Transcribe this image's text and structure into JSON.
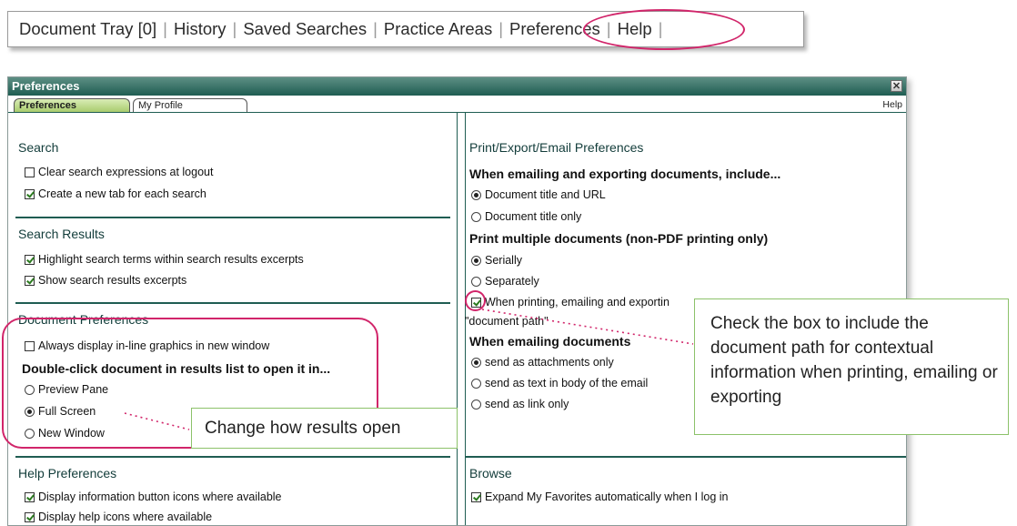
{
  "topnav": {
    "items": [
      {
        "label": "Document Tray [0]"
      },
      {
        "label": "History"
      },
      {
        "label": "Saved Searches"
      },
      {
        "label": "Practice Areas"
      },
      {
        "label": "Preferences"
      },
      {
        "label": "Help"
      }
    ],
    "separator": "|"
  },
  "window": {
    "title": "Preferences",
    "close_glyph": "✕",
    "help_label": "Help",
    "tabs": [
      {
        "label": "Preferences",
        "active": true
      },
      {
        "label": "My Profile",
        "active": false
      }
    ]
  },
  "left": {
    "search": {
      "title": "Search",
      "options": [
        {
          "label": "Clear search expressions at logout",
          "checked": false
        },
        {
          "label": "Create a new tab for each search",
          "checked": true
        }
      ]
    },
    "results": {
      "title": "Search Results",
      "options": [
        {
          "label": "Highlight search terms within search results excerpts",
          "checked": true
        },
        {
          "label": "Show search results excerpts",
          "checked": true
        }
      ]
    },
    "docprefs": {
      "title": "Document Preferences",
      "options": [
        {
          "label": "Always display in-line graphics in new window",
          "checked": false
        }
      ],
      "doubleclick_label": "Double-click document in results list to open it in...",
      "open_options": [
        {
          "label": "Preview Pane",
          "selected": false
        },
        {
          "label": "Full Screen",
          "selected": true
        },
        {
          "label": "New Window",
          "selected": false
        }
      ]
    },
    "help": {
      "title": "Help Preferences",
      "options": [
        {
          "label": "Display information button icons where available",
          "checked": true
        },
        {
          "label": "Display help icons where available",
          "checked": true
        }
      ]
    }
  },
  "right": {
    "print": {
      "title": "Print/Export/Email Preferences",
      "include_label": "When emailing and exporting documents, include...",
      "include_options": [
        {
          "label": "Document title and URL",
          "selected": true
        },
        {
          "label": "Document title only",
          "selected": false
        }
      ],
      "multi_label": "Print multiple documents (non-PDF printing only)",
      "multi_options": [
        {
          "label": "Serially",
          "selected": true
        },
        {
          "label": "Separately",
          "selected": false
        }
      ],
      "path_label_line1": "When printing, emailing and exportin",
      "path_label_line2": "\"document path\"",
      "path_checked": true,
      "email_label": "When emailing documents",
      "email_options": [
        {
          "label": "send as attachments only",
          "selected": true
        },
        {
          "label": "send as text in body of the email",
          "selected": false
        },
        {
          "label": "send as link only",
          "selected": false
        }
      ]
    },
    "browse": {
      "title": "Browse",
      "options": [
        {
          "label": "Expand My Favorites automatically when I log in",
          "checked": true
        }
      ]
    }
  },
  "callouts": {
    "results_open": "Change how results open",
    "doc_path": "Check the box to include the document path for contextual information when printing, emailing or exporting"
  },
  "colors": {
    "accent": "#d1256a",
    "callout_border": "#8cc26a",
    "titlebar": "#1f5d52"
  }
}
